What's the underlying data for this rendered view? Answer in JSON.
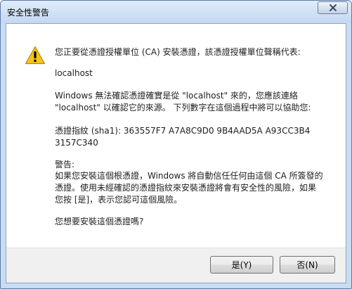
{
  "window": {
    "title": "安全性警告",
    "close_icon": "close-icon"
  },
  "message": {
    "intro": "您正要從憑證授權單位 (CA) 安裝憑證，該憑證授權單位聲稱代表:",
    "host": "localhost",
    "validate_line1": "Windows 無法確認憑證確實是從 \"localhost\" 來的，您應該連絡",
    "validate_line2": "\"localhost\" 以確認它的來源。 下列數字在這個過程中將可以協助您:",
    "thumb_line1": "憑證指紋 (sha1): 363557F7 A7A8C9D0 9B4AAD5A A93CC3B4",
    "thumb_line2": "3157C340",
    "warning_title": "警告:",
    "warning_line1": "如果您安裝這個根憑證，Windows 將自動信任任何由這個 CA 所簽發的",
    "warning_line2": "憑證。使用未經確認的憑證指紋來安裝憑證將會有安全性的風險，如果",
    "warning_line3": "您按 [是]，表示您認可這個風險。",
    "question": "您想要安裝這個憑證嗎?"
  },
  "buttons": {
    "yes": "是(Y)",
    "no": "否(N)"
  },
  "icons": {
    "warning": "warning-icon"
  },
  "colors": {
    "warning_fill": "#f5c518",
    "titlebar": "#cfe0f4"
  }
}
